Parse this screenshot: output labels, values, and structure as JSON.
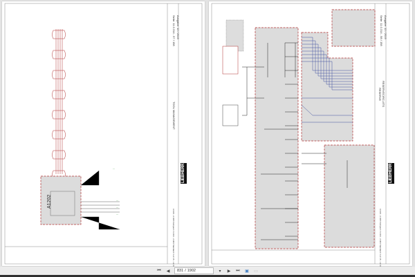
{
  "pages": [
    {
      "seite": "Seite: 11.0.314 - 57 / 198",
      "ausgabe": "Ausgabe: 12 / 2019",
      "title": "TOOL MANAGEMENT",
      "module_label": "A1202",
      "models": "A 910 - A 918 Compact / A 914 - A 924 Standard / LH 18 - LH 110",
      "brand": "LIEBHERR"
    },
    {
      "seite": "Seite: 11.0.314 - 58 / 198",
      "ausgabe": "Ausgabe: 12 / 2019",
      "title": "RESERVE",
      "subtitle": "RESERVECIRCUITS",
      "models": "A 910 - A 918 Compact / A 914 - A 924 Standard / LH 18 - LH 110",
      "brand": "LIEBHERR"
    }
  ],
  "toolbar": {
    "current_page": "831",
    "separator": "/",
    "total_pages": "1902",
    "first_icon": "first-page-icon",
    "prev_icon": "previous-page-icon",
    "next_icon": "next-page-icon",
    "last_icon": "last-page-icon"
  },
  "colors": {
    "wire_red": "#b03030",
    "wire_blue": "#4050a0",
    "module_fill": "#dcdcdc",
    "label_green": "#3a9a3a"
  }
}
